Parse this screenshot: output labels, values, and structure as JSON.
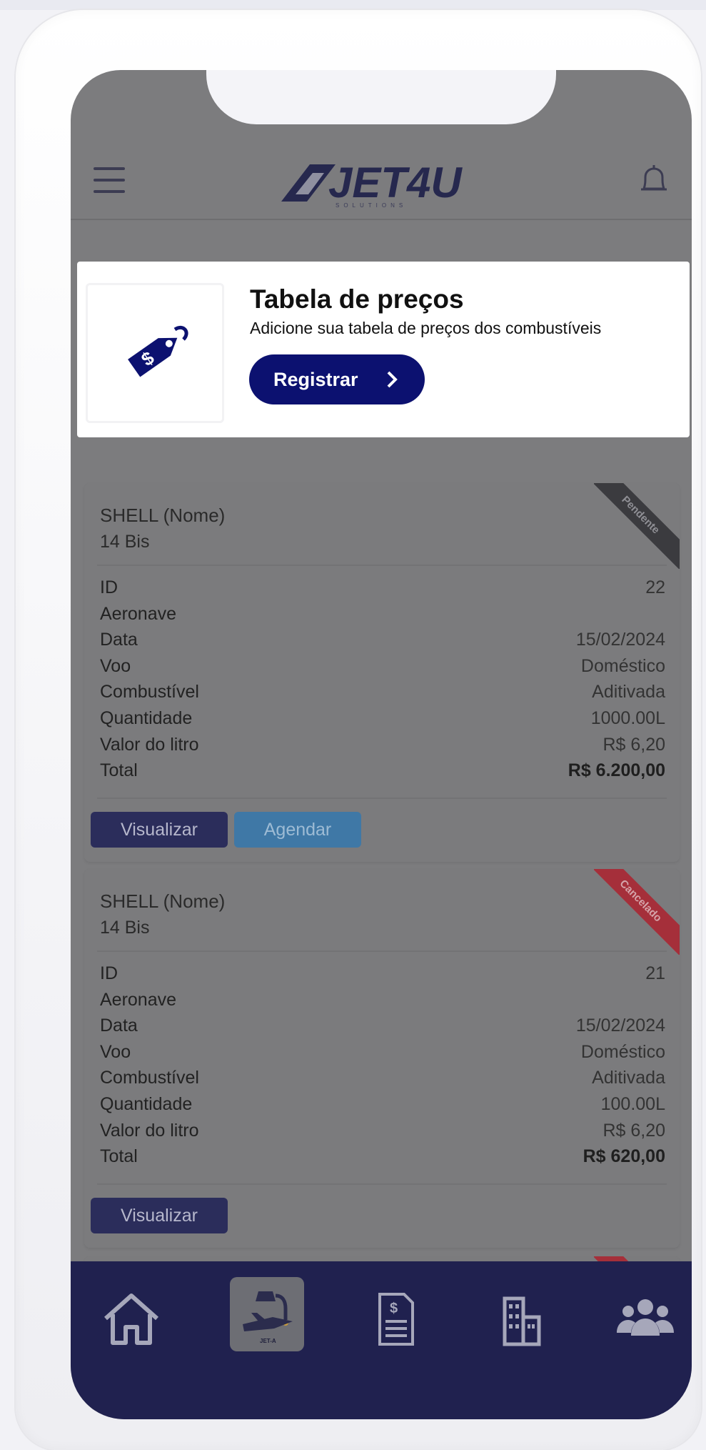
{
  "app": {
    "brand": "JET4U",
    "brand_sub": "SOLUTIONS"
  },
  "header": {
    "menu_icon": "hamburger-icon",
    "bell_icon": "bell-icon"
  },
  "banner": {
    "title": "Tabela de preços",
    "subtitle": "Adicione sua tabela de preços dos combustíveis",
    "button_label": "Registrar",
    "icon": "price-tag-icon"
  },
  "cards": [
    {
      "name": "SHELL (Nome)",
      "model": "14 Bis",
      "status": "Pendente",
      "fields": {
        "id_label": "ID",
        "id": "22",
        "aircraft_label": "Aeronave",
        "aircraft": "",
        "date_label": "Data",
        "date": "15/02/2024",
        "flight_label": "Voo",
        "flight": "Doméstico",
        "fuel_label": "Combustível",
        "fuel": "Aditivada",
        "quantity_label": "Quantidade",
        "quantity": "1000.00L",
        "price_label": "Valor do litro",
        "price": "R$ 6,20",
        "total_label": "Total",
        "total": "R$ 6.200,00"
      },
      "buttons": {
        "view": "Visualizar",
        "schedule": "Agendar"
      }
    },
    {
      "name": "SHELL (Nome)",
      "model": "14 Bis",
      "status": "Cancelado",
      "fields": {
        "id_label": "ID",
        "id": "21",
        "aircraft_label": "Aeronave",
        "aircraft": "",
        "date_label": "Data",
        "date": "15/02/2024",
        "flight_label": "Voo",
        "flight": "Doméstico",
        "fuel_label": "Combustível",
        "fuel": "Aditivada",
        "quantity_label": "Quantidade",
        "quantity": "100.00L",
        "price_label": "Valor do litro",
        "price": "R$ 6,20",
        "total_label": "Total",
        "total": "R$ 620,00"
      },
      "buttons": {
        "view": "Visualizar"
      }
    }
  ],
  "bottom_nav": {
    "items": [
      "home-icon",
      "fuel-pump-icon",
      "invoice-icon",
      "buildings-icon",
      "users-icon"
    ],
    "fuel_badge": "JET-A",
    "active_index": 1
  },
  "colors": {
    "primary": "#0c1170",
    "nav_bg": "#20214f",
    "ribbon_pending": "#3b3b3f",
    "ribbon_cancelled": "#a52f3a",
    "schedule_button": "#3f78a6"
  }
}
